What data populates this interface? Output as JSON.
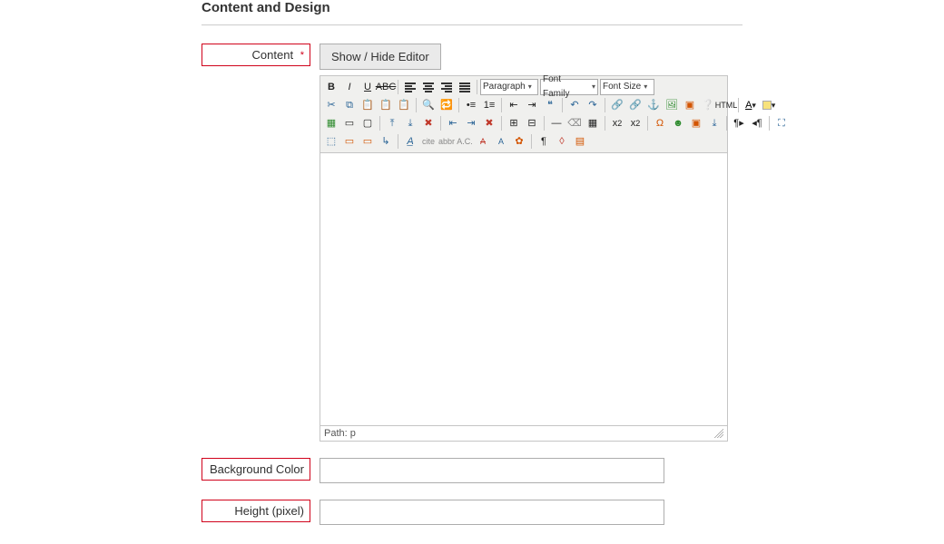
{
  "section": {
    "title": "Content and Design"
  },
  "fields": {
    "content": {
      "label": "Content",
      "required_mark": "*"
    },
    "background_color": {
      "label": "Background Color",
      "value": ""
    },
    "height_pixel": {
      "label": "Height (pixel)",
      "value": ""
    }
  },
  "buttons": {
    "toggle_editor": "Show / Hide Editor"
  },
  "editor": {
    "dropdowns": {
      "paragraph": "Paragraph",
      "font_family": "Font Family",
      "font_size": "Font Size"
    },
    "html_label": "HTML",
    "status_path": "Path: p"
  }
}
